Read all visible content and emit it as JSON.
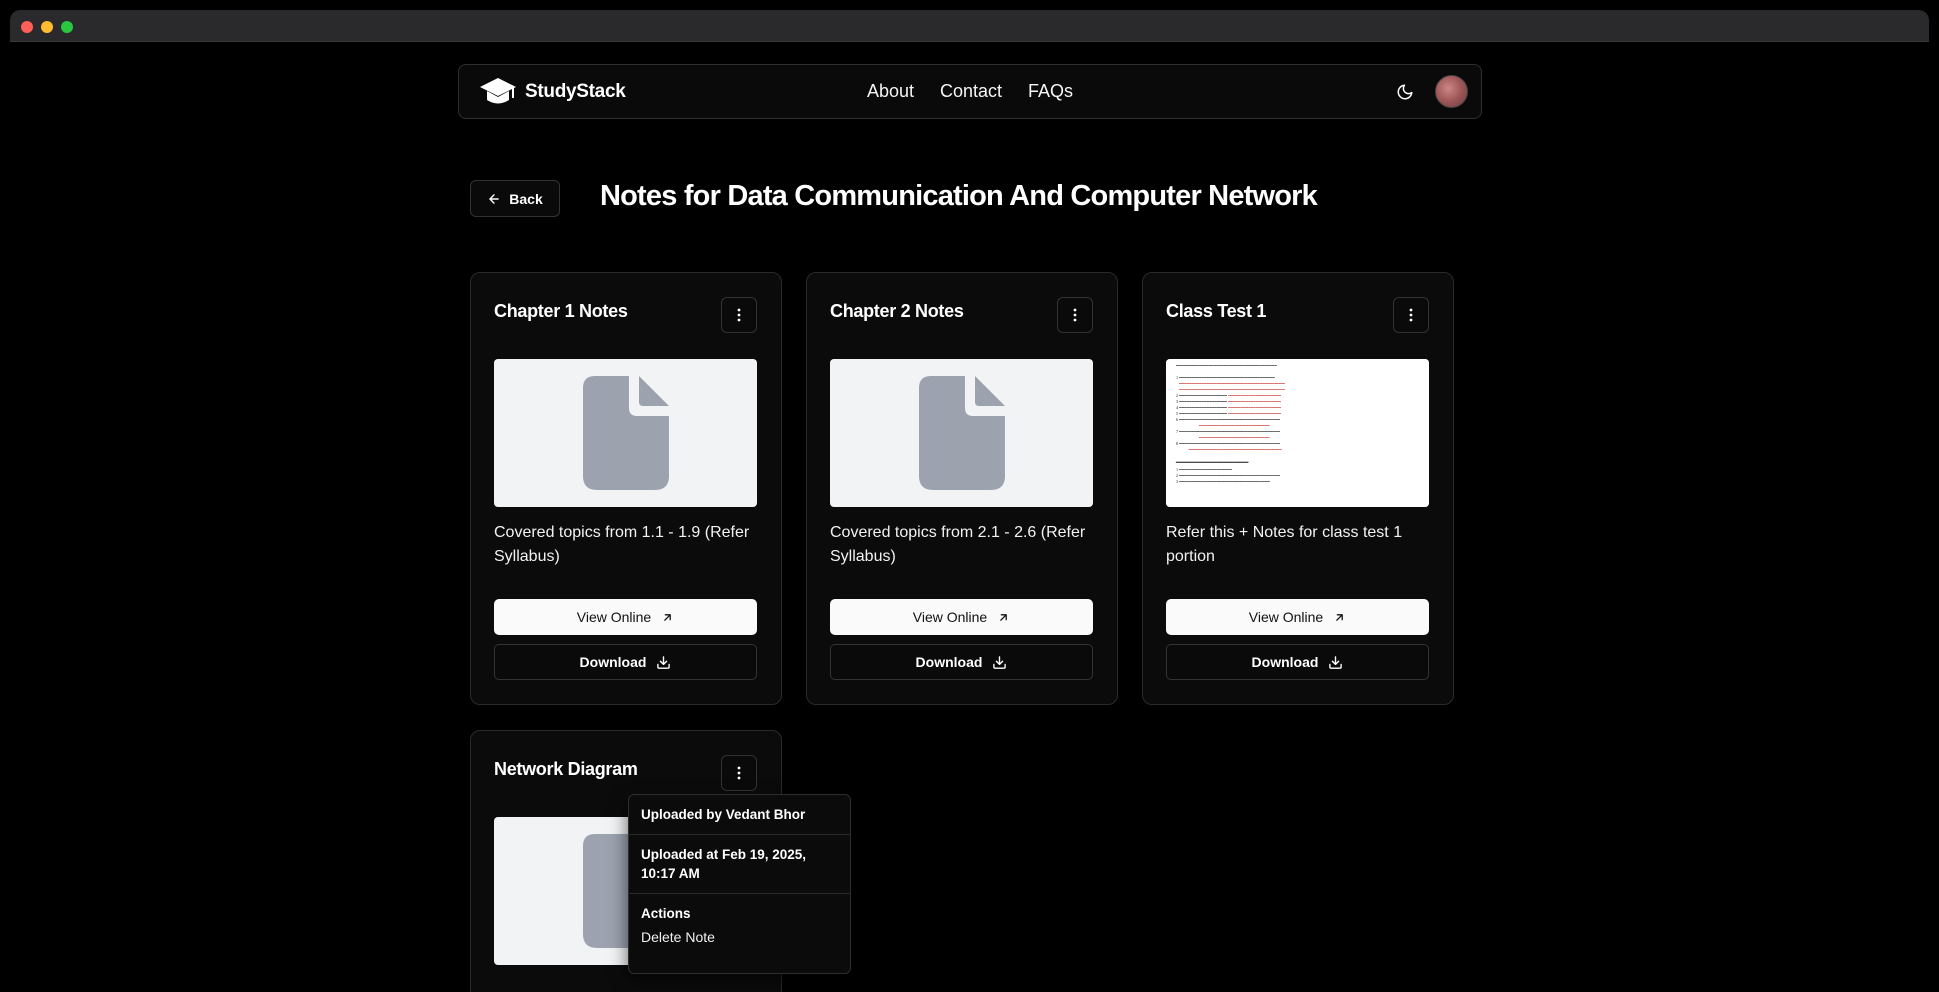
{
  "header": {
    "brand": "StudyStack",
    "nav": [
      "About",
      "Contact",
      "FAQs"
    ]
  },
  "page": {
    "back_label": "Back",
    "title": "Notes for Data Communication And Computer Network"
  },
  "cards": [
    {
      "title": "Chapter 1 Notes",
      "description": "Covered topics from 1.1 - 1.9 (Refer Syllabus)",
      "thumbnail": "file-icon",
      "view_label": "View Online",
      "download_label": "Download"
    },
    {
      "title": "Chapter 2 Notes",
      "description": "Covered topics from 2.1 - 2.6 (Refer Syllabus)",
      "thumbnail": "file-icon",
      "view_label": "View Online",
      "download_label": "Download"
    },
    {
      "title": "Class Test 1",
      "description": "Refer this + Notes for class test 1 portion",
      "thumbnail": "document-preview",
      "view_label": "View Online",
      "download_label": "Download"
    },
    {
      "title": "Network Diagram",
      "thumbnail": "file-icon"
    }
  ],
  "dropdown": {
    "uploaded_by": "Uploaded by Vedant Bhor",
    "uploaded_at": "Uploaded at Feb 19, 2025, 10:17 AM",
    "actions_heading": "Actions",
    "delete_label": "Delete Note"
  },
  "colors": {
    "background": "#000000",
    "card_bg": "#0b0b0b",
    "thumb_bg": "#f1f3f5",
    "file_icon": "#9ca3af",
    "view_button_bg": "#fafafa"
  }
}
